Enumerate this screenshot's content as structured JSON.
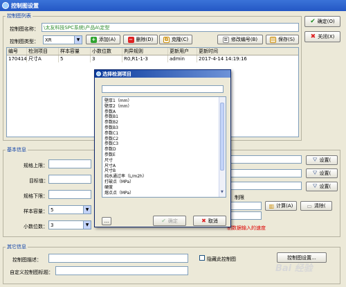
{
  "window": {
    "title": "控制图设置"
  },
  "chart_list": {
    "section_title": "控制图列表",
    "name_label": "控制图名称：",
    "name_value": "\\太友科技SPC系统\\产品A\\定型",
    "type_label": "控制图类型：",
    "type_value": "XR",
    "buttons": {
      "add": "添加(A)",
      "delete": "删除(D)",
      "clone": "克隆(C)",
      "edit_no": "修改编号(B)",
      "save": "保存(S)"
    },
    "columns": [
      "编号",
      "检测项目",
      "样本容量",
      "小数位数",
      "判异规则",
      "更新用户",
      "更新时间"
    ],
    "rows": [
      [
        "1704141...",
        "尺寸A",
        "5",
        "3",
        "R0,R1-1-3",
        "admin",
        "2017-4-14 14:19:16"
      ]
    ]
  },
  "right_buttons": {
    "ok": "确定(O)",
    "close": "关闭(X)"
  },
  "basic_info": {
    "section_title": "基本信息",
    "upper_label": "规格上限：",
    "target_label": "目标值：",
    "lower_label": "规格下限：",
    "sample_label": "样本容量：",
    "sample_value": "5",
    "decimals_label": "小数位数：",
    "decimals_value": "3",
    "settings_label": "设置(",
    "limit_label": "制限",
    "calc_label": "计算(A)",
    "clear_label": "清除(",
    "hint_text": "制数据输入的速度"
  },
  "other_info": {
    "section_title": "其它信息",
    "desc_label": "控制图描述：",
    "custom_title_label": "自定义控制图标题：",
    "hide_label": "隐藏此控制图",
    "chart_settings_label": "控制图设置..."
  },
  "dialog": {
    "title": "选择检测项目",
    "items": [
      "壁厚1（mm）",
      "壁厚2（mm）",
      "参数A",
      "参数B1",
      "参数B2",
      "参数B3",
      "参数C1",
      "参数C2",
      "参数C3",
      "参数D",
      "参数E",
      "尺寸",
      "尺寸A",
      "尺寸B",
      "纯水通过率（L/m2h）",
      "打破点（MPa）",
      "硬度",
      "熔点点（MPa）"
    ],
    "browse_label": "...",
    "ok_label": "确定",
    "cancel_label": "取消"
  },
  "watermark": {
    "text": "Bai 经验"
  },
  "colors": {
    "title_bar": "#2457c4",
    "group_title": "#0b3fa8",
    "warning_text": "#dd0000"
  }
}
